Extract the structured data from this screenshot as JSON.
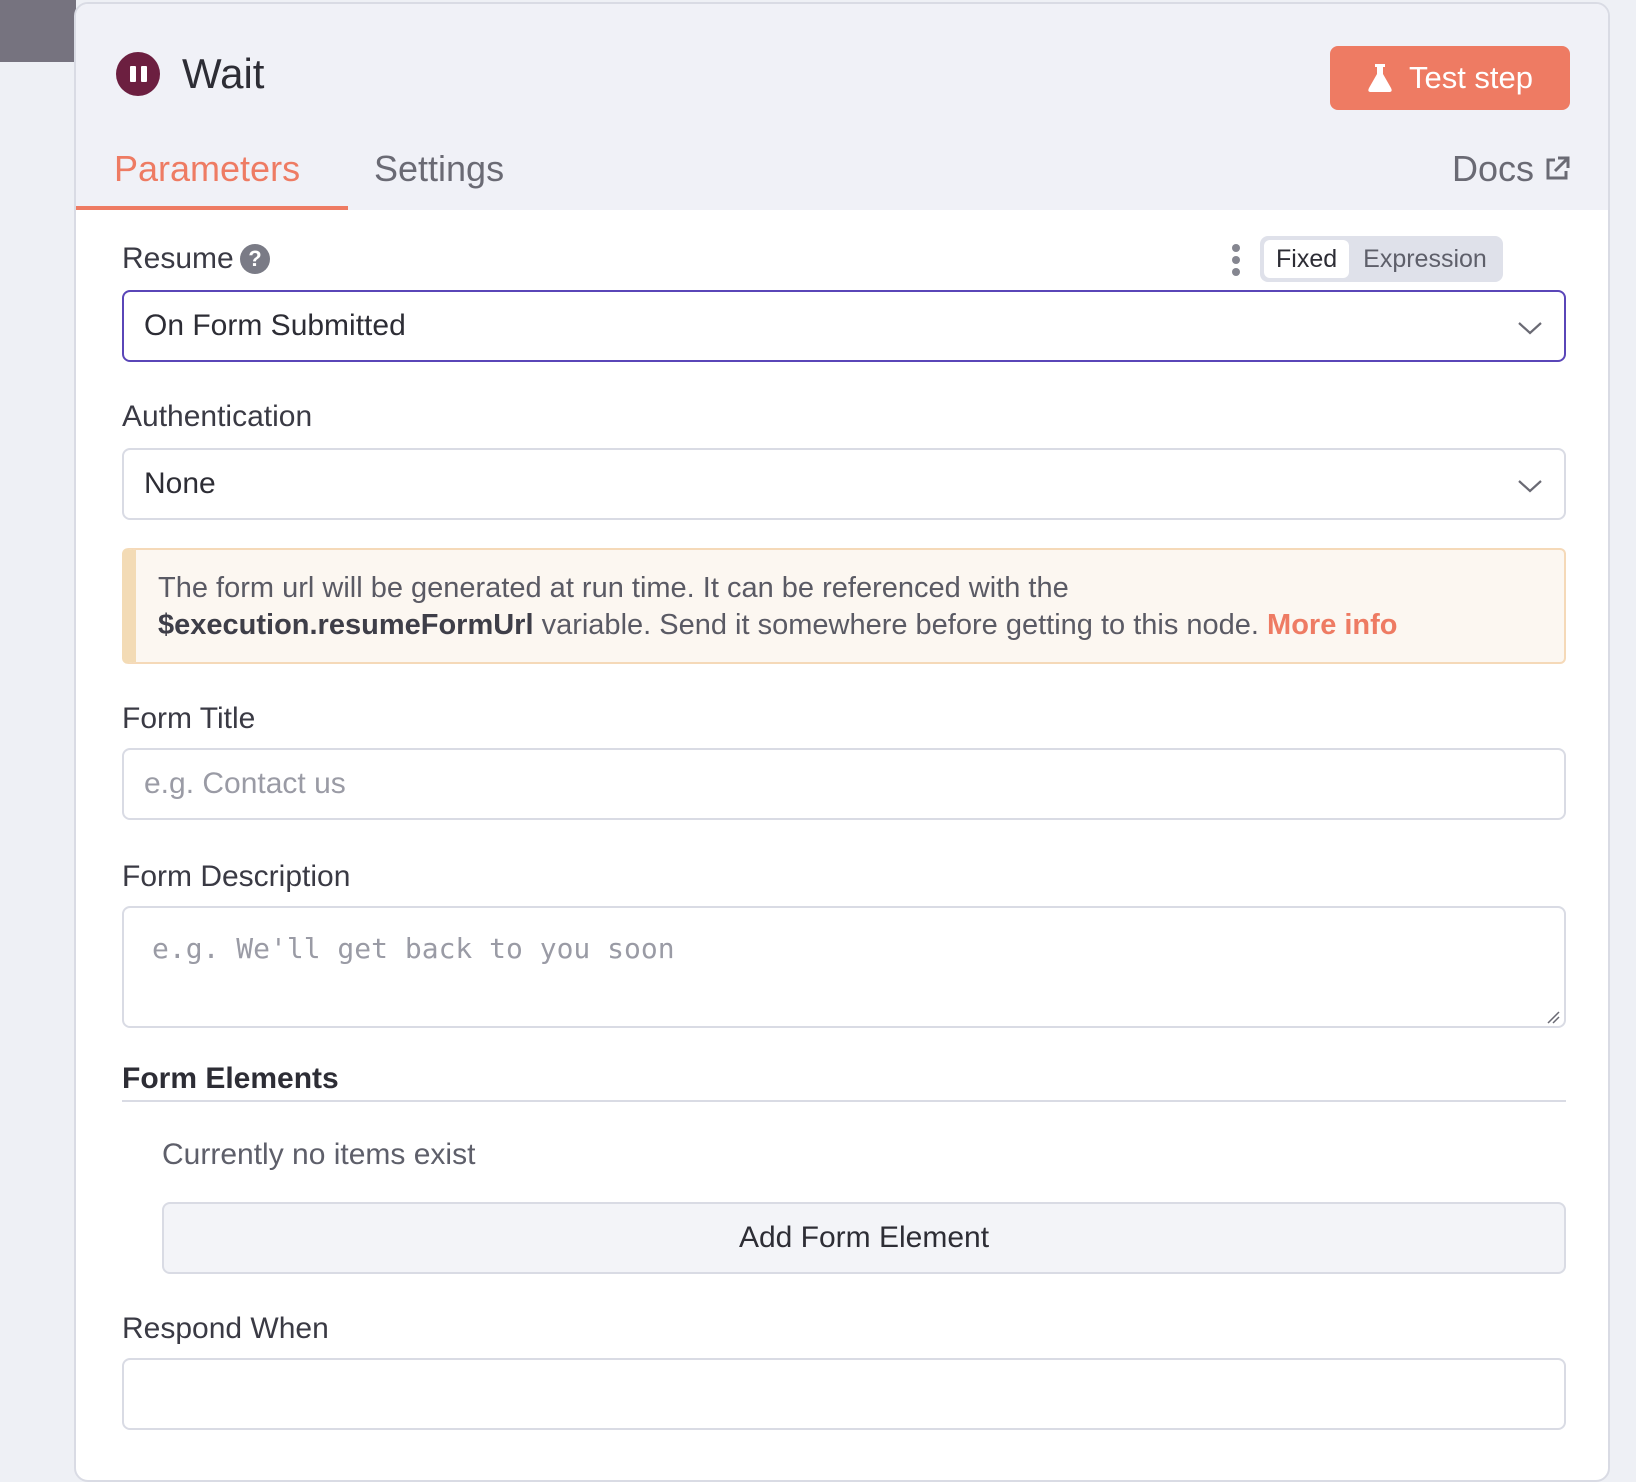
{
  "node": {
    "title": "Wait",
    "test_button_label": "Test step"
  },
  "tabs": [
    {
      "label": "Parameters",
      "active": true
    },
    {
      "label": "Settings",
      "active": false
    }
  ],
  "docs_label": "Docs",
  "resume": {
    "label": "Resume",
    "mode_options": [
      "Fixed",
      "Expression"
    ],
    "mode_selected": "Fixed",
    "value": "On Form Submitted"
  },
  "authentication": {
    "label": "Authentication",
    "value": "None"
  },
  "notice": {
    "text_before": "The form url will be generated at run time. It can be referenced with the",
    "variable": "$execution.resumeFormUrl",
    "text_after": "variable. Send it somewhere before getting to this node.",
    "link_label": "More info"
  },
  "form_title": {
    "label": "Form Title",
    "placeholder": "e.g. Contact us"
  },
  "form_description": {
    "label": "Form Description",
    "placeholder": "e.g. We'll get back to you soon"
  },
  "form_elements": {
    "label": "Form Elements",
    "empty_text": "Currently no items exist",
    "add_button_label": "Add Form Element"
  },
  "respond_when": {
    "label": "Respond When"
  },
  "colors": {
    "accent": "#ee7b63",
    "node_icon": "#6c1f40",
    "focus_border": "#5a46b8"
  }
}
